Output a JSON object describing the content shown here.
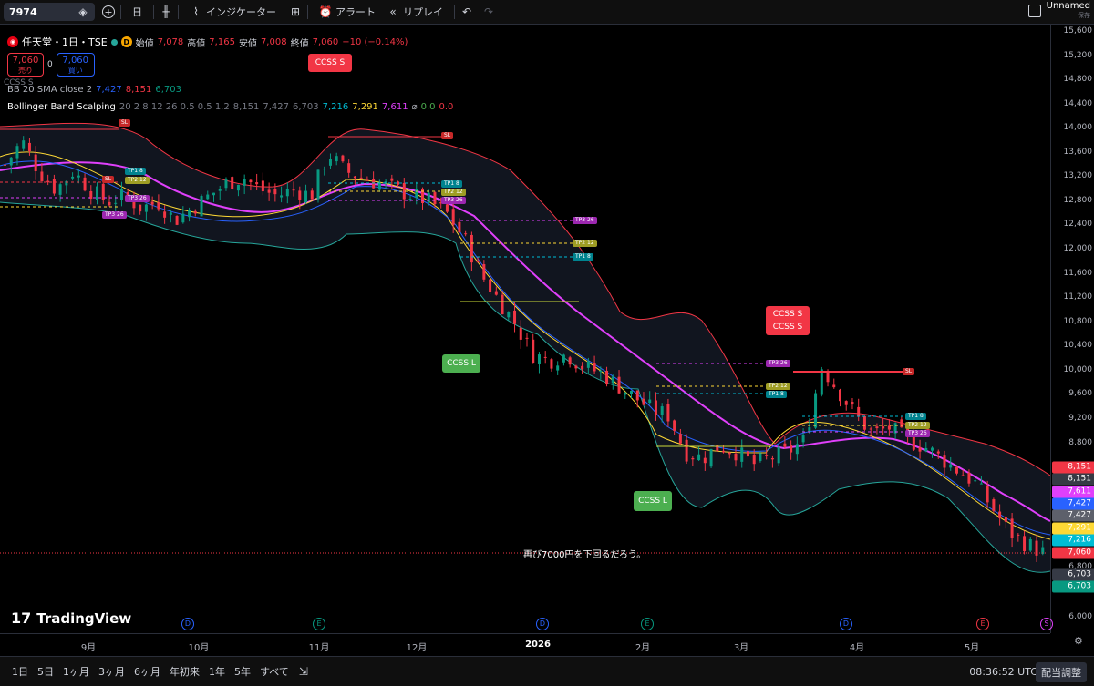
{
  "toolbar": {
    "symbol": "7974",
    "interval": "日",
    "indicators_label": "インジケーター",
    "alert_label": "アラート",
    "replay_label": "リプレイ",
    "layout_name": "Unnamed",
    "layout_saved": "保存"
  },
  "legend": {
    "title": "任天堂・1日・TSE",
    "badge": "D",
    "open_label": "始値",
    "open": "7,078",
    "high_label": "高値",
    "high": "7,165",
    "low_label": "安値",
    "low": "7,008",
    "close_label": "終値",
    "close": "7,060",
    "change": "−10 (−0.14%)",
    "sell_price": "7,060",
    "sell_label": "売り",
    "spread": "0",
    "buy_price": "7,060",
    "buy_label": "買い",
    "bb_name": "BB 20 SMA close 2",
    "bb_v1": "7,427",
    "bb_v2": "8,151",
    "bb_v3": "6,703",
    "bbs_name": "Bollinger Band Scalping",
    "bbs_params": "20 2 8 12 26 0.5 0.5 1.2",
    "bbs_v1": "8,151",
    "bbs_v2": "7,427",
    "bbs_v3": "6,703",
    "bbs_v4": "7,216",
    "bbs_v5": "7,291",
    "bbs_v6": "7,611",
    "bbs_v7": "0.0",
    "bbs_v8": "0.0",
    "ccss_overlay": "CCSS S"
  },
  "signals": {
    "ccss_s": "CCSS S",
    "ccss_l": "CCSS L"
  },
  "trade_tags": {
    "sl": "SL",
    "tp1": "TP1 8",
    "tp2": "TP2 12",
    "tp3": "TP3 26"
  },
  "annotation": "再び7000円を下回るだろう。",
  "price_axis": {
    "ticks": [
      "15,600",
      "15,200",
      "14,800",
      "14,400",
      "14,000",
      "13,600",
      "13,200",
      "12,800",
      "12,400",
      "12,000",
      "11,600",
      "11,200",
      "10,800",
      "10,400",
      "10,000",
      "9,600",
      "9,200",
      "8,800",
      "6,800",
      "6,400",
      "6,000"
    ],
    "tags": [
      {
        "label": "8,151",
        "color": "#f23645"
      },
      {
        "label": "8,151",
        "color": "#363a45"
      },
      {
        "label": "7,611",
        "color": "#e040fb"
      },
      {
        "label": "7,427",
        "color": "#2962ff"
      },
      {
        "label": "7,427",
        "color": "#5d606b"
      },
      {
        "label": "7,291",
        "color": "#fdd835"
      },
      {
        "label": "7,216",
        "color": "#00bcd4"
      },
      {
        "label": "7,060",
        "color": "#f23645"
      },
      {
        "label": "6,703",
        "color": "#363a45"
      },
      {
        "label": "6,703",
        "color": "#089981"
      }
    ]
  },
  "time_axis": {
    "ticks": [
      "9月",
      "10月",
      "11月",
      "12月",
      "2026",
      "2月",
      "3月",
      "4月",
      "5月"
    ],
    "events": [
      "D",
      "E",
      "D",
      "E",
      "D",
      "E",
      "S"
    ]
  },
  "bottom_bar": {
    "ranges": [
      "1日",
      "5日",
      "1ヶ月",
      "3ヶ月",
      "6ヶ月",
      "年初来",
      "1年",
      "5年",
      "すべて"
    ],
    "clock": "08:36:52 UTC",
    "adjust": "配当調整"
  },
  "brand": "TradingView",
  "chart_data": {
    "type": "candlestick",
    "ylim": [
      6000,
      15600
    ],
    "x_ticks": [
      "9月",
      "10月",
      "11月",
      "12月",
      "2026",
      "2月",
      "3月",
      "4月",
      "5月"
    ],
    "series": [
      {
        "name": "BB 20 SMA close 2",
        "values": [
          7427,
          8151,
          6703
        ]
      },
      {
        "name": "Bollinger Band Scalping"
      }
    ],
    "close_path": [
      13400,
      13800,
      13300,
      13000,
      13300,
      13000,
      12800,
      12900,
      12700,
      12800,
      12500,
      12700,
      12900,
      13100,
      13200,
      13000,
      12900,
      13000,
      12900,
      13600,
      13300,
      13200,
      13100,
      13000,
      12900,
      12800,
      12600,
      12200,
      11600,
      11200,
      10800,
      10300,
      10200,
      10300,
      10100,
      10000,
      9800,
      9600,
      9400,
      9300,
      8700,
      8600,
      8800,
      8700,
      8500,
      8600,
      8700,
      8900,
      10100,
      9700,
      9300,
      9000,
      9100,
      8900,
      8800,
      8600,
      8400,
      8200,
      7800,
      7400,
      7200,
      7060
    ]
  }
}
